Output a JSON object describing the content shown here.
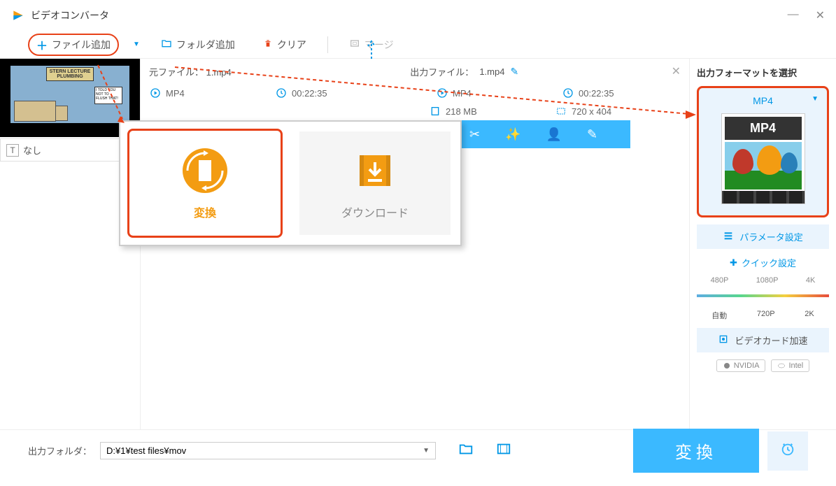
{
  "window": {
    "title": "ビデオコンバータ",
    "minimize": "—",
    "close": "✕"
  },
  "toolbar": {
    "add_file": "ファイル追加",
    "add_folder": "フォルダ追加",
    "clear": "クリア",
    "merge": "マージ"
  },
  "thumbnail": {
    "sign_line1": "STERN LECTURE",
    "sign_line2": "PLUMBING",
    "callout": "I TOLD YOU NOT TO FLUSH THAT!"
  },
  "title_field": {
    "value": "なし"
  },
  "file": {
    "source_label": "元ファイル：",
    "source_name": "1.mp4",
    "output_label": "出力ファイル：",
    "output_name": "1.mp4",
    "src_format": "MP4",
    "src_duration": "00:22:35",
    "dst_format": "MP4",
    "dst_duration": "00:22:35",
    "size": "218 MB",
    "resolution": "720 x 404"
  },
  "popup": {
    "convert": "変換",
    "download": "ダウンロード"
  },
  "right_panel": {
    "title": "出力フォーマットを選択",
    "format": "MP4",
    "format_badge": "MP4",
    "param_settings": "パラメータ設定",
    "quick_settings": "クイック設定",
    "res_480": "480P",
    "res_1080": "1080P",
    "res_4k": "4K",
    "auto": "自動",
    "res_720": "720P",
    "res_2k": "2K",
    "gpu_accel": "ビデオカード加速",
    "nvidia": "NVIDIA",
    "intel": "Intel"
  },
  "footer": {
    "label": "出力フォルダ：",
    "path": "D:¥1¥test files¥mov",
    "convert": "変換"
  }
}
